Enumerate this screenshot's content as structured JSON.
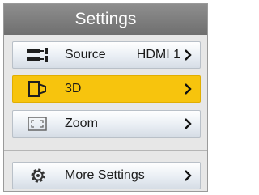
{
  "header": {
    "title": "Settings"
  },
  "menu": {
    "source": {
      "label": "Source",
      "value": "HDMI 1",
      "icon": "source-icon"
    },
    "three_d": {
      "label": "3D",
      "icon": "3d-icon"
    },
    "zoom": {
      "label": "Zoom",
      "icon": "zoom-icon"
    },
    "more": {
      "label": "More Settings",
      "icon": "gear-icon"
    }
  },
  "colors": {
    "header": "#7f7f7f",
    "selected": "#f7c40d",
    "panel": "#e7e7e7"
  }
}
